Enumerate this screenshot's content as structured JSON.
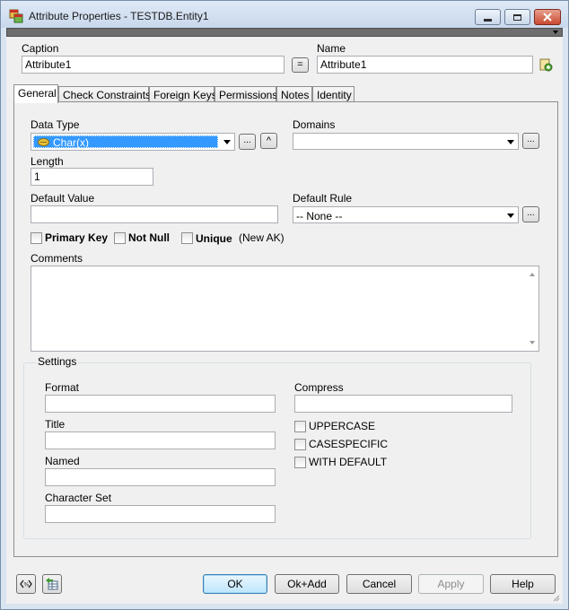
{
  "window": {
    "title": "Attribute Properties - TESTDB.Entity1",
    "icon": "entity-attribute-icon",
    "buttons": [
      "minimize-icon",
      "maximize-icon",
      "close-icon"
    ]
  },
  "header": {
    "caption_label": "Caption",
    "caption_value": "Attribute1",
    "equals_button": "=",
    "name_label": "Name",
    "name_value": "Attribute1"
  },
  "tabs": [
    {
      "label": "General",
      "active": true
    },
    {
      "label": "Check Constraints",
      "active": false
    },
    {
      "label": "Foreign Keys",
      "active": false
    },
    {
      "label": "Permissions",
      "active": false
    },
    {
      "label": "Notes",
      "active": false
    },
    {
      "label": "Identity",
      "active": false
    }
  ],
  "general": {
    "data_type_label": "Data Type",
    "data_type_value": "Char(x)",
    "ellipsis": "...",
    "caret": "^",
    "domains_label": "Domains",
    "domains_value": "",
    "length_label": "Length",
    "length_value": "1",
    "default_value_label": "Default Value",
    "default_value": "",
    "default_rule_label": "Default Rule",
    "default_rule_value": "-- None --",
    "primary_key_label": "Primary Key",
    "not_null_label": "Not Null",
    "unique_label": "Unique",
    "new_ak_label": "(New AK)",
    "comments_label": "Comments",
    "comments_value": ""
  },
  "settings": {
    "group_label": "Settings",
    "format_label": "Format",
    "title_label": "Title",
    "named_label": "Named",
    "character_set_label": "Character Set",
    "compress_label": "Compress",
    "uppercase_label": "UPPERCASE",
    "casespecific_label": "CASESPECIFIC",
    "with_default_label": "WITH DEFAULT"
  },
  "footer": {
    "ok_label": "OK",
    "ok_add_label": "Ok+Add",
    "cancel_label": "Cancel",
    "apply_label": "Apply",
    "help_label": "Help"
  },
  "colors": {
    "selection": "#3399ff",
    "title_bar": "#c8d8ec",
    "close_button": "#c94a2f"
  }
}
